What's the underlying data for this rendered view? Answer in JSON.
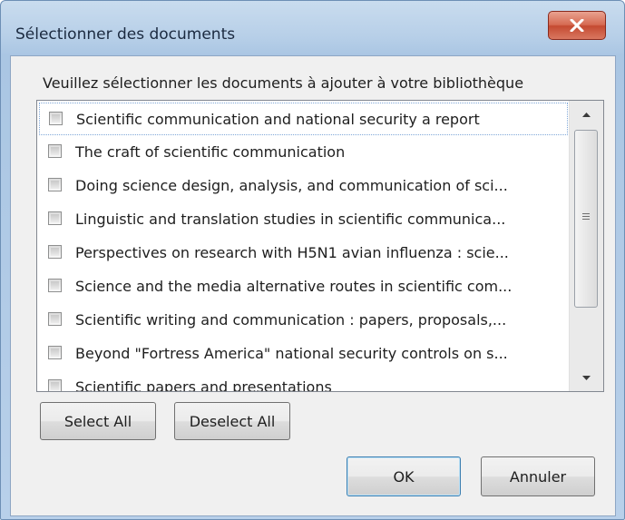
{
  "window": {
    "title": "Sélectionner des documents",
    "close_glyph": "x"
  },
  "dialog": {
    "instruction": "Veuillez sélectionner les documents à ajouter à votre bibliothèque",
    "items": [
      {
        "label": "Scientific communication and national security a report",
        "checked": false,
        "focused": true
      },
      {
        "label": "The craft of scientific communication",
        "checked": false
      },
      {
        "label": "Doing science design, analysis, and communication of sci...",
        "checked": false
      },
      {
        "label": "Linguistic and translation studies in scientific communica...",
        "checked": false
      },
      {
        "label": "Perspectives on research with H5N1 avian influenza : scie...",
        "checked": false
      },
      {
        "label": "Science and the media alternative routes in scientific com...",
        "checked": false
      },
      {
        "label": "Scientific writing and communication : papers, proposals,...",
        "checked": false
      },
      {
        "label": "Beyond \"Fortress America\" national security controls on s...",
        "checked": false
      },
      {
        "label": "Scientific papers and presentations",
        "checked": false
      }
    ],
    "select_all_label": "Select All",
    "deselect_all_label": "Deselect All",
    "ok_label": "OK",
    "cancel_label": "Annuler"
  }
}
